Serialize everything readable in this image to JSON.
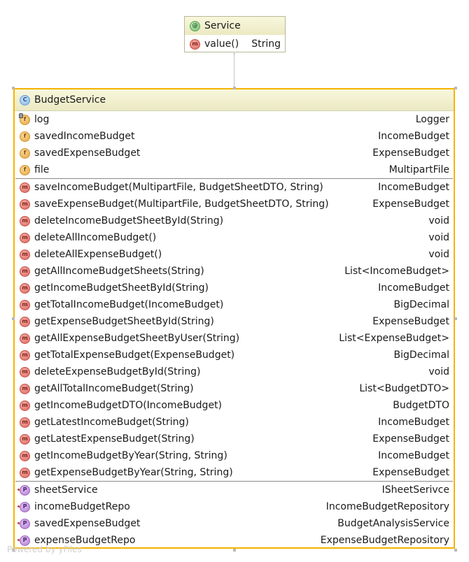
{
  "service": {
    "title": "Service",
    "title_icon": "annotation-icon",
    "method": {
      "name": "value()",
      "type": "String",
      "icon": "method-icon"
    }
  },
  "budget_service": {
    "title": "BudgetService",
    "title_icon": "class-icon",
    "fields": [
      {
        "name": "log",
        "type": "Logger",
        "icon": "final-field-icon"
      },
      {
        "name": "savedIncomeBudget",
        "type": "IncomeBudget",
        "icon": "field-icon"
      },
      {
        "name": "savedExpenseBudget",
        "type": "ExpenseBudget",
        "icon": "field-icon"
      },
      {
        "name": "file",
        "type": "MultipartFile",
        "icon": "field-icon"
      }
    ],
    "methods": [
      {
        "name": "saveIncomeBudget(MultipartFile, BudgetSheetDTO, String)",
        "type": "IncomeBudget"
      },
      {
        "name": "saveExpenseBudget(MultipartFile, BudgetSheetDTO, String)",
        "type": "ExpenseBudget"
      },
      {
        "name": "deleteIncomeBudgetSheetById(String)",
        "type": "void"
      },
      {
        "name": "deleteAllIncomeBudget()",
        "type": "void"
      },
      {
        "name": "deleteAllExpenseBudget()",
        "type": "void"
      },
      {
        "name": "getAllIncomeBudgetSheets(String)",
        "type": "List<IncomeBudget>"
      },
      {
        "name": "getIncomeBudgetSheetById(String)",
        "type": "IncomeBudget"
      },
      {
        "name": "getTotalIncomeBudget(IncomeBudget)",
        "type": "BigDecimal"
      },
      {
        "name": "getExpenseBudgetSheetById(String)",
        "type": "ExpenseBudget"
      },
      {
        "name": "getAllExpenseBudgetSheetByUser(String)",
        "type": "List<ExpenseBudget>"
      },
      {
        "name": "getTotalExpenseBudget(ExpenseBudget)",
        "type": "BigDecimal"
      },
      {
        "name": "deleteExpenseBudgetById(String)",
        "type": "void"
      },
      {
        "name": "getAllTotalIncomeBudget(String)",
        "type": "List<BudgetDTO>"
      },
      {
        "name": "getIncomeBudgetDTO(IncomeBudget)",
        "type": "BudgetDTO"
      },
      {
        "name": "getLatestIncomeBudget(String)",
        "type": "IncomeBudget"
      },
      {
        "name": "getLatestExpenseBudget(String)",
        "type": "ExpenseBudget"
      },
      {
        "name": "getIncomeBudgetByYear(String, String)",
        "type": "IncomeBudget"
      },
      {
        "name": "getExpenseBudgetByYear(String, String)",
        "type": "ExpenseBudget"
      }
    ],
    "properties": [
      {
        "name": "sheetService",
        "type": "ISheetSerivce"
      },
      {
        "name": "incomeBudgetRepo",
        "type": "IncomeBudgetRepository"
      },
      {
        "name": "savedExpenseBudget",
        "type": "BudgetAnalysisService"
      },
      {
        "name": "expenseBudgetRepo",
        "type": "ExpenseBudgetRepository"
      }
    ]
  },
  "watermark": "Powered by yFiles",
  "colors": {
    "selection_border": "#f5b400",
    "header_bg": "#f2f0cf",
    "method_icon": "#dc645a",
    "field_icon": "#e4a53c",
    "property_icon": "#b07ad2"
  }
}
